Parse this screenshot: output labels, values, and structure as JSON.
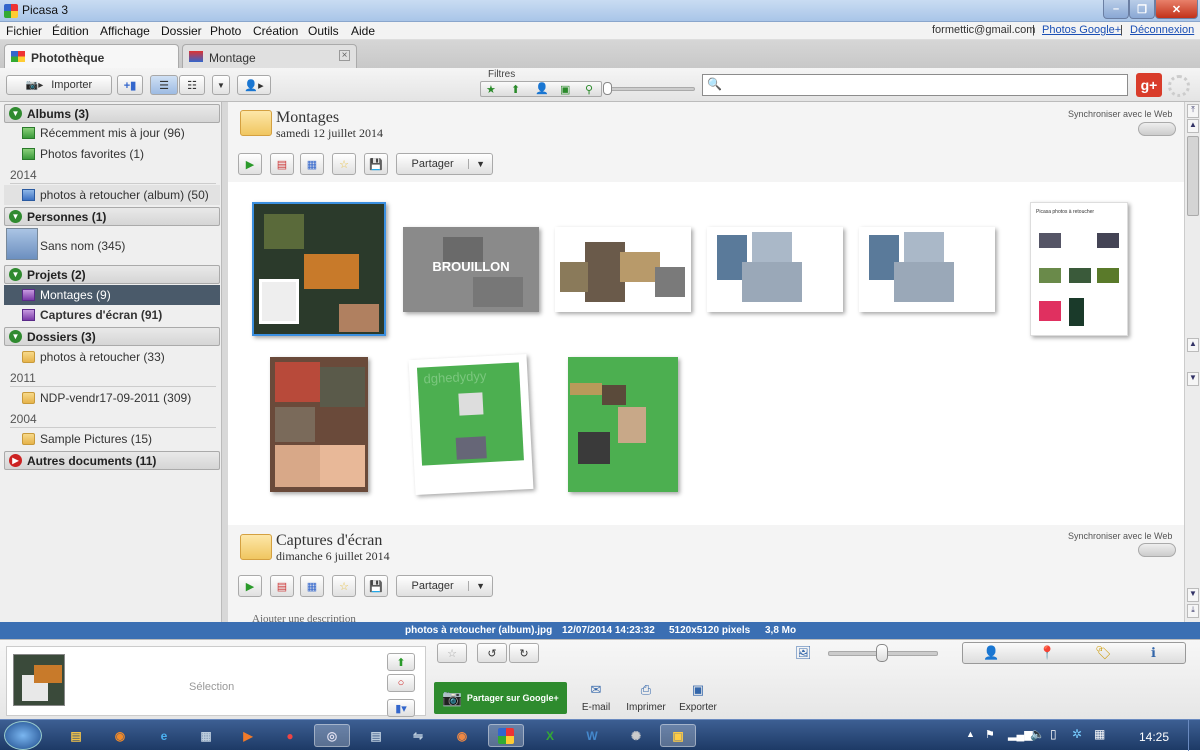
{
  "window": {
    "title": "Picasa 3"
  },
  "menu": [
    "Fichier",
    "Édition",
    "Affichage",
    "Dossier",
    "Photo",
    "Création",
    "Outils",
    "Aide"
  ],
  "account": {
    "email": "formettic@gmail.com",
    "sep1": "|",
    "google_photos": "Photos Google+",
    "sep2": "|",
    "logout": "Déconnexion"
  },
  "tabs": [
    {
      "label": "Photothèque"
    },
    {
      "label": "Montage"
    }
  ],
  "toolbar": {
    "import_label": "Importer",
    "filters_label": "Filtres"
  },
  "sidebar": {
    "albums_header": "Albums (3)",
    "albums": [
      {
        "label": "Récemment mis à jour (96)"
      },
      {
        "label": "Photos favorites (1)"
      }
    ],
    "year_2014": "2014",
    "album_2014": "photos à retoucher (album) (50)",
    "people_header": "Personnes (1)",
    "person": "Sans nom (345)",
    "projects_header": "Projets (2)",
    "projects": [
      {
        "label": "Montages (9)"
      },
      {
        "label": "Captures d'écran (91)"
      }
    ],
    "folders_header": "Dossiers (3)",
    "folder1": "photos à retoucher (33)",
    "year_2011": "2011",
    "folder2": "NDP-vendr17-09-2011 (309)",
    "year_2004": "2004",
    "folder3": "Sample Pictures (15)",
    "other_header": "Autres documents (11)"
  },
  "sections": [
    {
      "title": "Montages",
      "date": "samedi 12 juillet 2014",
      "sync": "Synchroniser avec le Web",
      "share": "Partager"
    },
    {
      "title": "Captures d'écran",
      "date": "dimanche 6 juillet 2014",
      "sync": "Synchroniser avec le Web",
      "share": "Partager",
      "description": "Ajouter une description"
    }
  ],
  "thumbs": {
    "brouillon": "BROUILLON",
    "green_text": "dghedydyy",
    "doc_title": "Picasa photos à retoucher"
  },
  "status": {
    "filename": "photos à retoucher (album).jpg",
    "datetime": "12/07/2014 14:23:32",
    "dimensions": "5120x5120 pixels",
    "size": "3,8 Mo"
  },
  "bottom": {
    "selection": "Sélection",
    "share_google": "Partager sur Google+",
    "email": "E-mail",
    "print": "Imprimer",
    "export": "Exporter"
  },
  "taskbar": {
    "clock": "14:25"
  },
  "colors": {
    "status_bar": "#3b6fb3",
    "google_share": "#2e8b2e",
    "selection": "#4a5a6a"
  }
}
